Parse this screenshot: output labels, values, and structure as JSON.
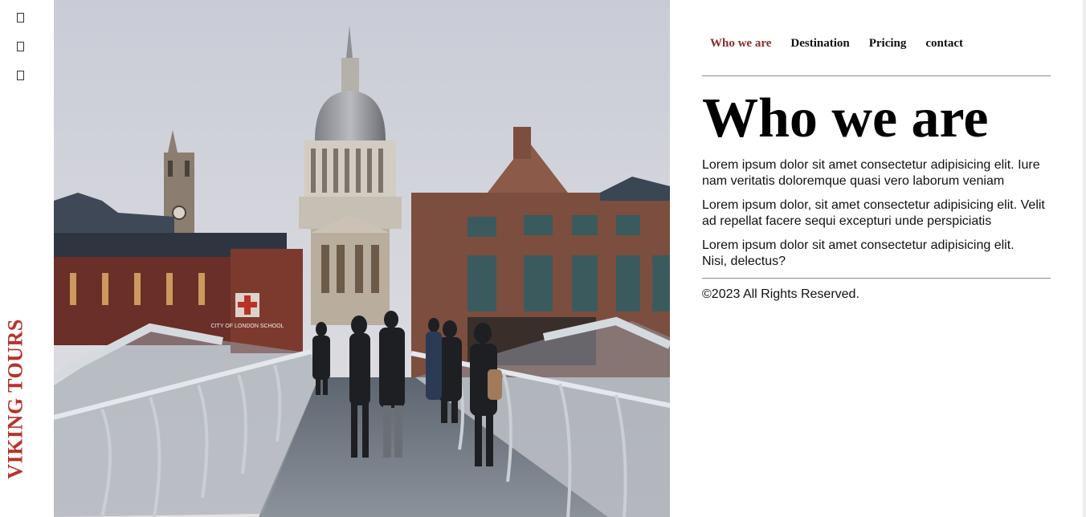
{
  "sidebar": {
    "icons": [
      "social-icon-1",
      "social-icon-2",
      "social-icon-3"
    ],
    "brand": "VIKING TOURS"
  },
  "hero": {
    "signage": "CITY OF LONDON SCHOOL"
  },
  "nav": {
    "items": [
      {
        "label": "Who we are",
        "active": true
      },
      {
        "label": "Destination",
        "active": false
      },
      {
        "label": "Pricing",
        "active": false
      },
      {
        "label": "contact",
        "active": false
      }
    ]
  },
  "main": {
    "title": "Who we are",
    "paragraphs": [
      "Lorem ipsum dolor sit amet consectetur adipisicing elit. Iure nam veritatis doloremque quasi vero laborum veniam",
      "Lorem ipsum dolor, sit amet consectetur adipisicing elit. Velit ad repellat facere sequi excepturi unde perspiciatis",
      "Lorem ipsum dolor sit amet consectetur adipisicing elit. Nisi, delectus?"
    ]
  },
  "footer": {
    "copyright": "©2023 All Rights Reserved."
  },
  "colors": {
    "brand_red": "#b8322a",
    "active_nav": "#8b2a2a"
  }
}
